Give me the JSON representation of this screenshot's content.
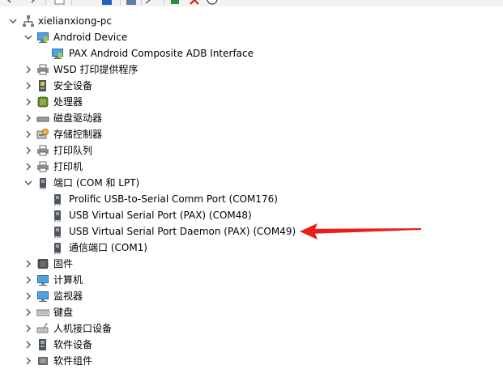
{
  "toolbar": {
    "buttons": [
      {
        "icon": "back-arrow-icon"
      },
      {
        "icon": "forward-arrow-icon"
      },
      {
        "icon": "properties-icon"
      },
      {
        "icon": "help-icon"
      },
      {
        "icon": "scan-hardware-icon"
      },
      {
        "icon": "update-driver-icon"
      },
      {
        "icon": "uninstall-x-icon"
      },
      {
        "icon": "download-icon"
      }
    ]
  },
  "tree": {
    "root": {
      "label": "xielianxiong-pc",
      "icon": "computer-network-icon",
      "expanded": true
    },
    "items": [
      {
        "label": "Android Device",
        "level": 1,
        "expanded": true,
        "icon": "android-device-icon"
      },
      {
        "label": "PAX Android Composite ADB Interface",
        "level": 2,
        "icon": "android-device-icon"
      },
      {
        "label": "WSD 打印提供程序",
        "level": 1,
        "expanded": false,
        "icon": "printer-icon"
      },
      {
        "label": "安全设备",
        "level": 1,
        "expanded": false,
        "icon": "security-device-icon"
      },
      {
        "label": "处理器",
        "level": 1,
        "expanded": false,
        "icon": "processor-icon"
      },
      {
        "label": "磁盘驱动器",
        "level": 1,
        "expanded": false,
        "icon": "disk-drive-icon"
      },
      {
        "label": "存储控制器",
        "level": 1,
        "expanded": false,
        "icon": "storage-controller-icon"
      },
      {
        "label": "打印队列",
        "level": 1,
        "expanded": false,
        "icon": "printer-icon"
      },
      {
        "label": "打印机",
        "level": 1,
        "expanded": false,
        "icon": "printer-icon"
      },
      {
        "label": "端口 (COM 和 LPT)",
        "level": 1,
        "expanded": true,
        "icon": "port-icon"
      },
      {
        "label": "Prolific USB-to-Serial Comm Port (COM176)",
        "level": 2,
        "icon": "port-icon"
      },
      {
        "label": "USB Virtual Serial Port (PAX) (COM48)",
        "level": 2,
        "icon": "port-icon"
      },
      {
        "label": "USB Virtual Serial Port Daemon (PAX) (COM49)",
        "level": 2,
        "icon": "port-icon"
      },
      {
        "label": "通信端口 (COM1)",
        "level": 2,
        "icon": "port-icon"
      },
      {
        "label": "固件",
        "level": 1,
        "expanded": false,
        "icon": "firmware-icon"
      },
      {
        "label": "计算机",
        "level": 1,
        "expanded": false,
        "icon": "monitor-icon"
      },
      {
        "label": "监视器",
        "level": 1,
        "expanded": false,
        "icon": "monitor-icon"
      },
      {
        "label": "键盘",
        "level": 1,
        "expanded": false,
        "icon": "keyboard-icon"
      },
      {
        "label": "人机接口设备",
        "level": 1,
        "expanded": false,
        "icon": "hid-icon"
      },
      {
        "label": "软件设备",
        "level": 1,
        "expanded": false,
        "icon": "software-device-icon"
      },
      {
        "label": "软件组件",
        "level": 1,
        "expanded": false,
        "icon": "software-component-icon"
      }
    ]
  },
  "annotation": {
    "type": "red-arrow",
    "points_to": "USB Virtual Serial Port Daemon (PAX) (COM49)",
    "color": "#e8201b"
  },
  "colors": {
    "background": "#ffffff",
    "text": "#000000",
    "chevron": "#555555",
    "arrow": "#e8201b",
    "toolbar": "#f3f3f3"
  }
}
